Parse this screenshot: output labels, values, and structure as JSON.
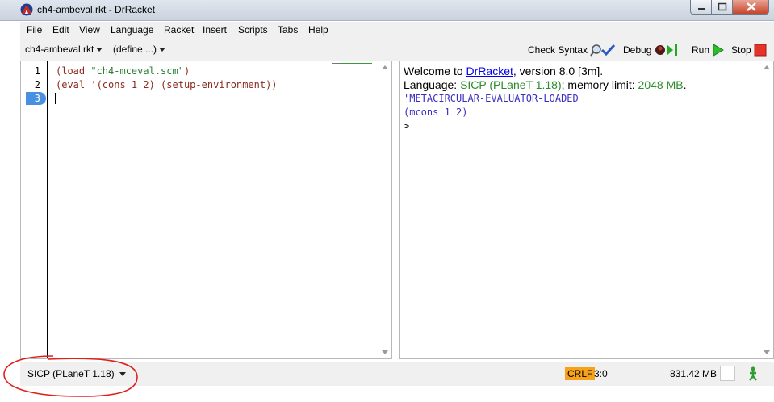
{
  "window": {
    "title": "ch4-ambeval.rkt - DrRacket"
  },
  "menu": [
    "File",
    "Edit",
    "View",
    "Language",
    "Racket",
    "Insert",
    "Scripts",
    "Tabs",
    "Help"
  ],
  "toolbar": {
    "file_menu": "ch4-ambeval.rkt",
    "define_menu": "(define ...)",
    "check_syntax": "Check Syntax",
    "debug": "Debug",
    "run": "Run",
    "stop": "Stop"
  },
  "editor": {
    "line_numbers": [
      "1",
      "2",
      "3"
    ],
    "lines": [
      [
        {
          "t": "(load ",
          "c": "#8b2b1e"
        },
        {
          "t": "\"ch4-mceval.scm\"",
          "c": "#2e7d32"
        },
        {
          "t": ")",
          "c": "#8b2b1e"
        }
      ],
      [
        {
          "t": "(eval '(cons 1 2) (setup-environment))",
          "c": "#8b2b1e"
        }
      ],
      []
    ]
  },
  "repl": {
    "welcome_prefix": "Welcome to ",
    "welcome_link": "DrRacket",
    "welcome_suffix": ", version 8.0 [3m].",
    "language_prefix": "Language: ",
    "language_name": "SICP (PLaneT 1.18)",
    "memory_prefix": "; memory limit: ",
    "memory_limit": "2048 MB",
    "memory_suffix": ".",
    "output_1": "'METACIRCULAR-EVALUATOR-LOADED",
    "output_2": "(mcons 1 2)",
    "prompt": ">"
  },
  "status": {
    "language": "SICP (PLaneT 1.18)",
    "line_ending": "CRLF",
    "position": "3:0",
    "memory": "831.42 MB"
  },
  "colors": {
    "accent_blue": "#4a90e2",
    "link": "#0000ee",
    "language_green": "#2e8b2e",
    "output_blue": "#3b2fbf",
    "crlf_bg": "#f7a21b",
    "annotation_red": "#e0201b"
  }
}
